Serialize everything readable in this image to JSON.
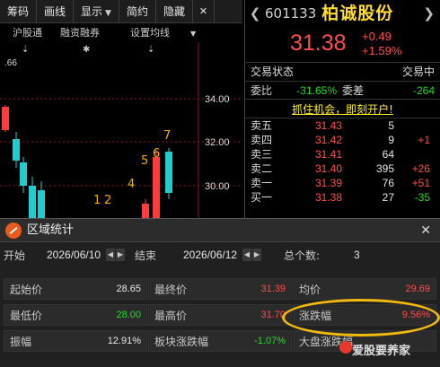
{
  "toolbar": {
    "items": [
      "筹码",
      "画线",
      "显示",
      "简约",
      "隐藏"
    ],
    "close": "✕"
  },
  "subtabs": [
    "沪股通",
    "融资融券",
    "设置均线"
  ],
  "chart": {
    "yaxis_labels": [
      "34.00",
      "32.00",
      "30.00"
    ],
    "left_value": ".66",
    "markers": [
      "1",
      "2",
      "4",
      "5",
      "6",
      "7"
    ],
    "colors": {
      "up": "#ff3b3b",
      "down": "#22cccc",
      "marker": "#f0b000",
      "grid": "#8a1a1a"
    }
  },
  "quote": {
    "code": "601133",
    "name": "柏诚股份",
    "price": "31.38",
    "change": "+0.49",
    "change_pct": "+1.59%",
    "status_label": "交易状态",
    "status_value": "交易中",
    "weibi_label": "委比",
    "weibi_value": "-31.65%",
    "weicha_label": "委差",
    "weicha_value": "-264",
    "banner": "抓住机会，即刻开户!",
    "orderbook": [
      {
        "label": "卖五",
        "price": "31.43",
        "vol": "5",
        "chg": ""
      },
      {
        "label": "卖四",
        "price": "31.42",
        "vol": "9",
        "chg": "+1"
      },
      {
        "label": "卖三",
        "price": "31.41",
        "vol": "64",
        "chg": ""
      },
      {
        "label": "卖二",
        "price": "31.40",
        "vol": "395",
        "chg": "+26"
      },
      {
        "label": "卖一",
        "price": "31.39",
        "vol": "76",
        "chg": "+51"
      },
      {
        "label": "买一",
        "price": "31.38",
        "vol": "27",
        "chg": "-35"
      }
    ]
  },
  "dialog": {
    "title": "区域统计",
    "close": "✕",
    "start_label": "开始",
    "start_date": "2026/06/10",
    "end_label": "结束",
    "end_date": "2026/06/12",
    "count_label": "总个数:",
    "count_value": "3",
    "stats": [
      {
        "key": "起始价",
        "value": "28.65",
        "color": "white"
      },
      {
        "key": "最终价",
        "value": "31.39",
        "color": "red"
      },
      {
        "key": "均价",
        "value": "29.69",
        "color": "red"
      },
      {
        "key": "最低价",
        "value": "28.00",
        "color": "green"
      },
      {
        "key": "最高价",
        "value": "31.70",
        "color": "red"
      },
      {
        "key": "涨跌幅",
        "value": "9.56%",
        "color": "red"
      },
      {
        "key": "振幅",
        "value": "12.91%",
        "color": "white"
      },
      {
        "key": "板块涨跌幅",
        "value": "-1.07%",
        "color": "green"
      },
      {
        "key": "大盘涨跌幅",
        "value": "",
        "color": "white"
      }
    ]
  },
  "watermark": "爱股要养家"
}
